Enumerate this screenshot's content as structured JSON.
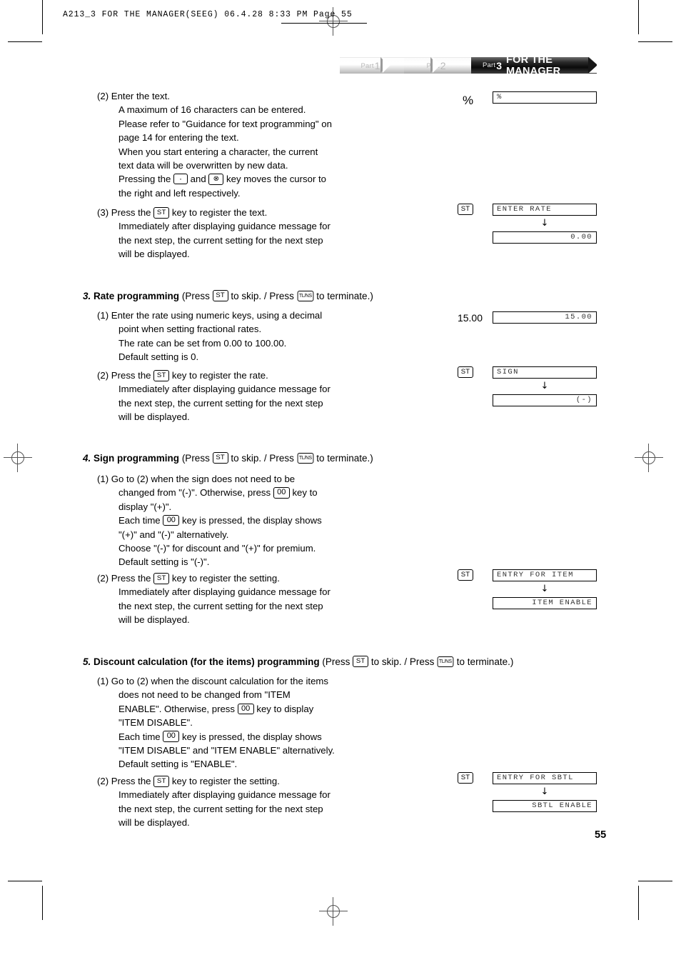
{
  "slug": {
    "text": "A213_3  FOR THE MANAGER(SEEG)   06.4.28 8:33 PM   Page 55"
  },
  "banner": {
    "part1_label": "Part",
    "part1_num": "1",
    "part2_label": "Part",
    "part2_num": "2",
    "part3_label": "Part",
    "part3_num": "3",
    "title": "FOR THE MANAGER"
  },
  "keys": {
    "st": "ST",
    "tlns": "TL/NS",
    "zero_zero": "00",
    "dot": "·",
    "backspace": "⊗"
  },
  "step2": {
    "marker": "(2)",
    "lines": [
      "Enter the text.",
      "A maximum of 16 characters can be entered.",
      "Please refer to \"Guidance for text programming\" on",
      "page 14 for entering the text.",
      "When you start entering a character, the current",
      "text data will be overwritten by new data.",
      "the right and left respectively."
    ],
    "key_line_pre": "Pressing the",
    "key_line_mid": "and",
    "key_line_post": "key moves the cursor to"
  },
  "step3": {
    "marker": "(3)",
    "line_pre": "Press the",
    "line_post": "key to register the text.",
    "lines": [
      "Immediately after displaying guidance message for",
      "the next step, the current setting for the next step",
      "will be displayed."
    ]
  },
  "section3": {
    "num": "3.",
    "name": "Rate programming",
    "paren_open": "(Press",
    "skip_text": "to skip. / Press",
    "terminate_text": "to terminate.)",
    "item1": {
      "marker": "(1)",
      "lines": [
        "Enter the rate using numeric keys, using a decimal",
        "point when setting fractional rates.",
        "The rate can be set from 0.00 to 100.00.",
        "Default setting is 0."
      ]
    },
    "item2": {
      "marker": "(2)",
      "line_pre": "Press the",
      "line_post": "key to register the rate.",
      "lines": [
        "Immediately after displaying guidance message for",
        "the next step, the current setting for the next step",
        "will be displayed."
      ]
    }
  },
  "section4": {
    "num": "4.",
    "name": "Sign programming",
    "paren_open": "(Press",
    "skip_text": "to skip. / Press",
    "terminate_text": "to terminate.)",
    "item1": {
      "marker": "(1)",
      "l1": "Go to (2) when the sign does not need to be",
      "l2_pre": "changed from \"(-)\".  Otherwise, press",
      "l2_post": "key to",
      "l3": "display \"(+)\".",
      "l4_pre": "Each time",
      "l4_post": "key is pressed, the display shows",
      "l5": "\"(+)\" and \"(-)\" alternatively.",
      "l6": "Choose \"(-)\" for discount and \"(+)\" for premium.",
      "l7": "Default setting is \"(-)\"."
    },
    "item2": {
      "marker": "(2)",
      "line_pre": "Press the",
      "line_post": "key to register the setting.",
      "lines": [
        "Immediately after displaying guidance message for",
        "the next step, the current setting for the next step",
        "will be displayed."
      ]
    }
  },
  "section5": {
    "num": "5.",
    "name": "Discount calculation (for the items) programming",
    "paren_open": "(Press",
    "skip_text": "to skip. / Press",
    "terminate_text": "to terminate.)",
    "item1": {
      "marker": "(1)",
      "l1": "Go to (2) when the discount calculation for the items",
      "l2": "does not need to be changed from \"ITEM",
      "l3_pre": "ENABLE\".  Otherwise, press",
      "l3_post": "key to display",
      "l4": "\"ITEM DISABLE\".",
      "l5_pre": "Each time",
      "l5_post": "key is pressed, the display shows",
      "l6": "\"ITEM DISABLE\" and \"ITEM ENABLE\" alternatively.",
      "l7": "Default setting is \"ENABLE\"."
    },
    "item2": {
      "marker": "(2)",
      "line_pre": "Press the",
      "line_post": "key to register the setting.",
      "lines": [
        "Immediately after displaying guidance message for",
        "the next step, the current setting for the next step",
        "will be displayed."
      ]
    }
  },
  "displays": {
    "percent": {
      "label": "%",
      "lcd": "%"
    },
    "enter_rate": {
      "key": "ST",
      "top": "ENTER RATE",
      "arrow": "↓",
      "bottom": "0.00"
    },
    "rate_value": {
      "label": "15.00",
      "lcd": "15.00"
    },
    "sign": {
      "key": "ST",
      "top": "SIGN",
      "arrow": "↓",
      "bottom": "(-)"
    },
    "entry_for_item": {
      "key": "ST",
      "top": "ENTRY FOR ITEM",
      "arrow": "↓",
      "bottom": "ITEM ENABLE"
    },
    "entry_for_sbtl": {
      "key": "ST",
      "top": "ENTRY FOR SBTL",
      "arrow": "↓",
      "bottom": "SBTL ENABLE"
    }
  },
  "page_number": "55"
}
